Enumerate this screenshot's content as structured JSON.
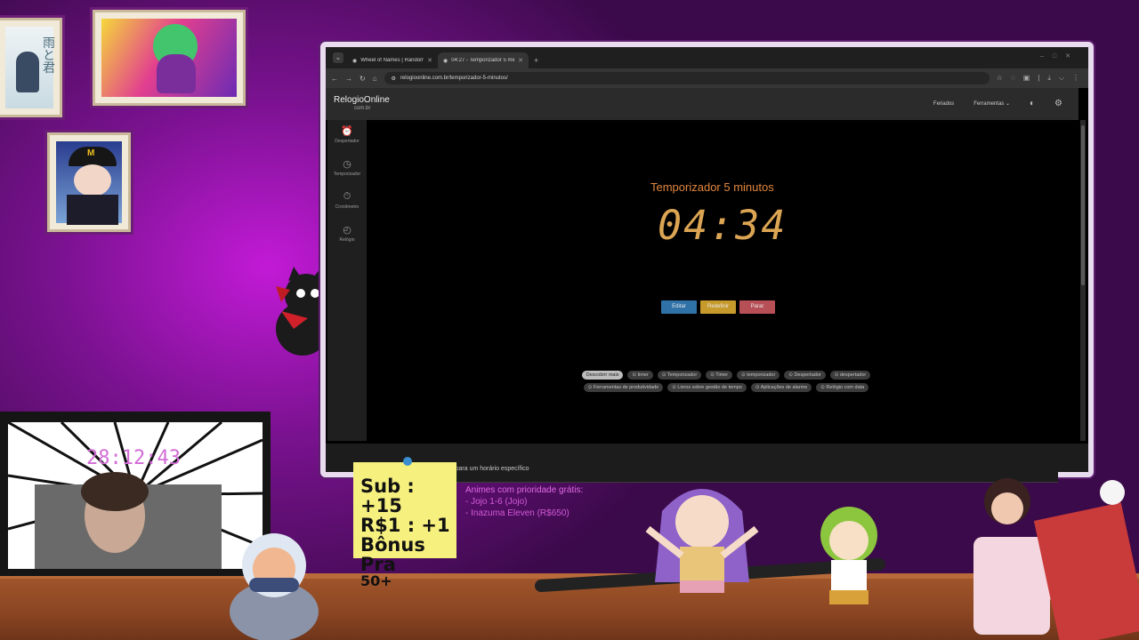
{
  "browser": {
    "tabs": [
      {
        "title": "Wheel of Names | Random nam",
        "active": false
      },
      {
        "title": "04:27 - Temporizador 5 minuto",
        "active": true
      }
    ],
    "url": "relogioonline.com.br/temporizador-5-minutos/"
  },
  "site": {
    "logo": "RelogioOnline",
    "logo_sub": "com.br",
    "nav": {
      "feriados": "Feriados",
      "ferramentas": "Ferramentas"
    },
    "sidebar": [
      {
        "label": "Despertador",
        "icon": "alarm-clock-icon"
      },
      {
        "label": "Temporizador",
        "icon": "timer-icon"
      },
      {
        "label": "Cronômetro",
        "icon": "stopwatch-icon"
      },
      {
        "label": "Relógio",
        "icon": "clock-icon"
      }
    ],
    "timer_title": "Temporizador 5 minutos",
    "timer_value": "04:34",
    "buttons": {
      "edit": "Editar",
      "redo": "Redefinir",
      "stop": "Parar"
    },
    "chips": [
      {
        "label": "Descobrir mais",
        "light": true
      },
      {
        "label": "⊙ timer",
        "light": false
      },
      {
        "label": "⊙ Temporizador",
        "light": false
      },
      {
        "label": "⊙ Timer",
        "light": false
      },
      {
        "label": "⊙ temporizador",
        "light": false
      },
      {
        "label": "⊙ Despertador",
        "light": false
      },
      {
        "label": "⊙ despertador",
        "light": false
      },
      {
        "label": "⊙ Ferramentas de produtividade",
        "light": false
      },
      {
        "label": "⊙ Livros sobre gestão de tempo",
        "light": false
      },
      {
        "label": "⊙ Aplicações de alarme",
        "light": false
      },
      {
        "label": "⊙ Relógio com data",
        "light": false
      }
    ],
    "details": "Definir um temporizador para um horário específico"
  },
  "stream": {
    "cam_timer": "28:12:43",
    "note_line1": "Sub : +15",
    "note_line2": "R$1 : +1",
    "note_line3": "Bônus Pra",
    "note_line4": "50+",
    "anime_header": "Animes com prioridade grátis:",
    "anime_items": [
      "- Jojo 1-6 (Jojo)",
      "- Inazuma Eleven (R$650)"
    ]
  }
}
